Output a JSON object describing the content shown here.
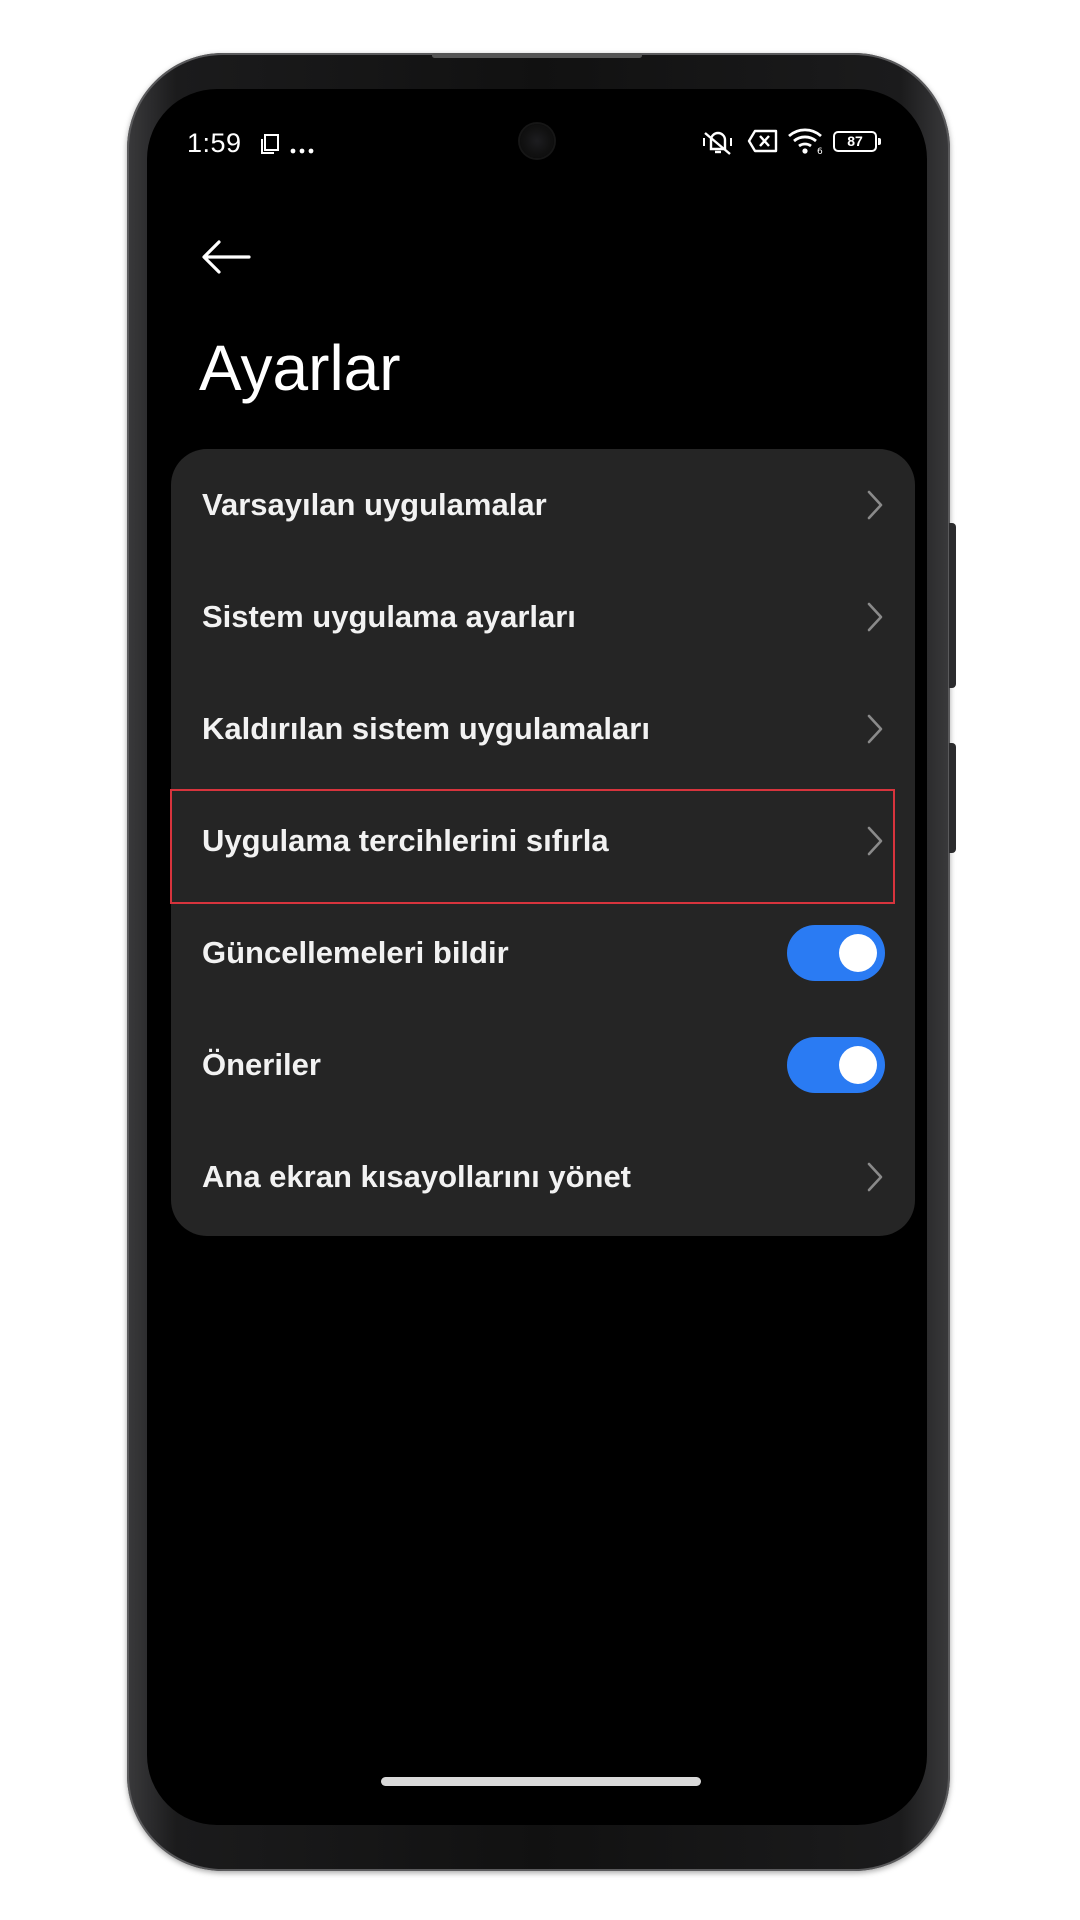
{
  "status_bar": {
    "time": "1:59",
    "battery": "87",
    "icons": [
      "screenshot-icon",
      "more-dots-icon",
      "mute-vibrate-icon",
      "sim-off-icon",
      "wifi-icon",
      "battery-icon"
    ]
  },
  "header": {
    "back_icon": "back-arrow-icon",
    "title": "Ayarlar"
  },
  "settings": [
    {
      "label": "Varsayılan uygulamalar",
      "control": "chevron"
    },
    {
      "label": "Sistem uygulama ayarları",
      "control": "chevron"
    },
    {
      "label": "Kaldırılan sistem uygulamaları",
      "control": "chevron"
    },
    {
      "label": "Uygulama tercihlerini sıfırla",
      "control": "chevron",
      "highlighted": true
    },
    {
      "label": "Güncellemeleri bildir",
      "control": "toggle",
      "on": true
    },
    {
      "label": "Öneriler",
      "control": "toggle",
      "on": true
    },
    {
      "label": "Ana ekran kısayollarını yönet",
      "control": "chevron"
    }
  ],
  "colors": {
    "background": "#000000",
    "card": "#252525",
    "toggle_on": "#2a7bf3",
    "highlight_border": "#d7343d"
  }
}
